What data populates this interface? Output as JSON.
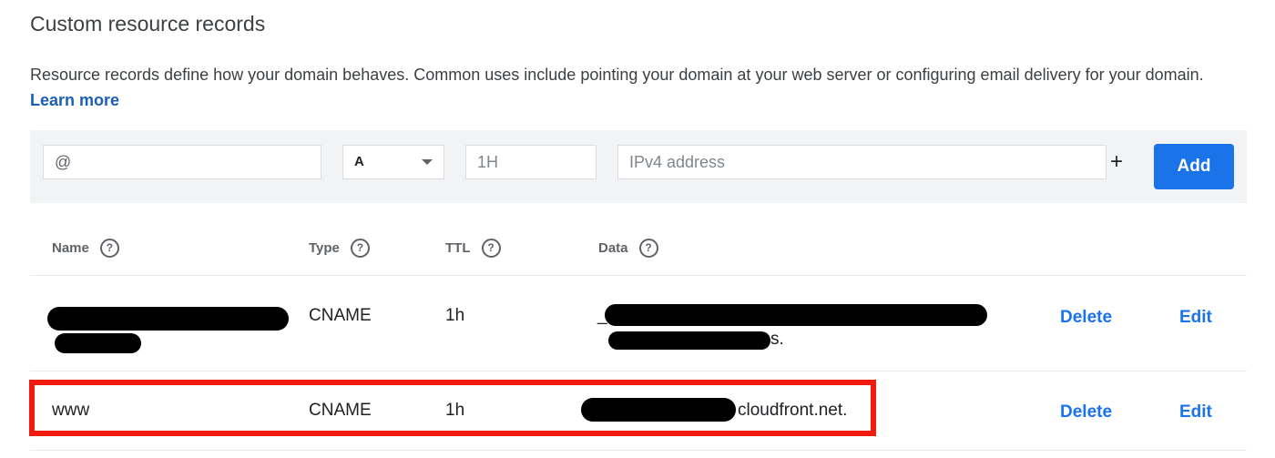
{
  "section": {
    "title": "Custom resource records",
    "description": "Resource records define how your domain behaves. Common uses include pointing your domain at your web server or configuring email delivery for your domain.",
    "learn_more": "Learn more"
  },
  "add_form": {
    "name_value": "@",
    "type_value": "A",
    "ttl_placeholder": "1H",
    "data_placeholder": "IPv4 address",
    "plus_symbol": "+",
    "add_label": "Add"
  },
  "table": {
    "headers": {
      "name": "Name",
      "type": "Type",
      "ttl": "TTL",
      "data": "Data"
    },
    "rows": [
      {
        "name": "",
        "type": "CNAME",
        "ttl": "1h",
        "data": "_",
        "data_suffix": "s.",
        "delete": "Delete",
        "edit": "Edit"
      },
      {
        "name": "www",
        "type": "CNAME",
        "ttl": "1h",
        "data": "cloudfront.net.",
        "delete": "Delete",
        "edit": "Edit"
      }
    ]
  },
  "colors": {
    "accent": "#1a73e8",
    "highlight": "#f21c0e"
  }
}
